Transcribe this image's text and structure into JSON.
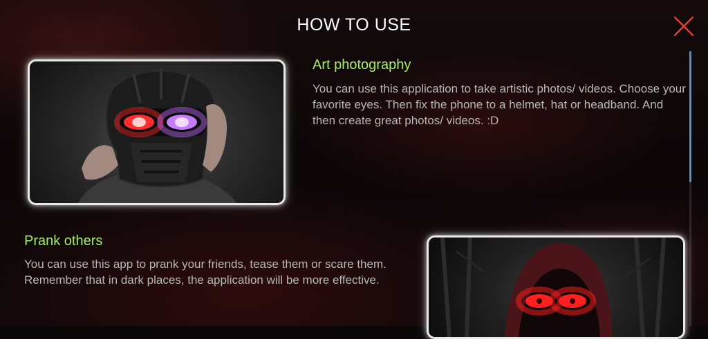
{
  "header": {
    "title": "HOW TO USE"
  },
  "sections": [
    {
      "heading": "Art photography",
      "description": "You can use this application to take artistic photos/ videos. Choose your favorite eyes. Then fix the phone to a helmet, hat or headband. And then create great photos/ videos. :D",
      "image": "helmet-glowing-eyes-photo"
    },
    {
      "heading": "Prank others",
      "description": "You can use this app to prank your friends, tease them or scare them. Remember that in dark places, the application will be more effective.",
      "image": "hooded-figure-red-eyes-photo"
    }
  ],
  "colors": {
    "heading": "#a5ee5c",
    "text": "#b8b8b8",
    "title": "#ffffff",
    "close": "#e0433a",
    "scroll_thumb": "#5b8fc9"
  },
  "icons": {
    "close": "close-icon"
  }
}
